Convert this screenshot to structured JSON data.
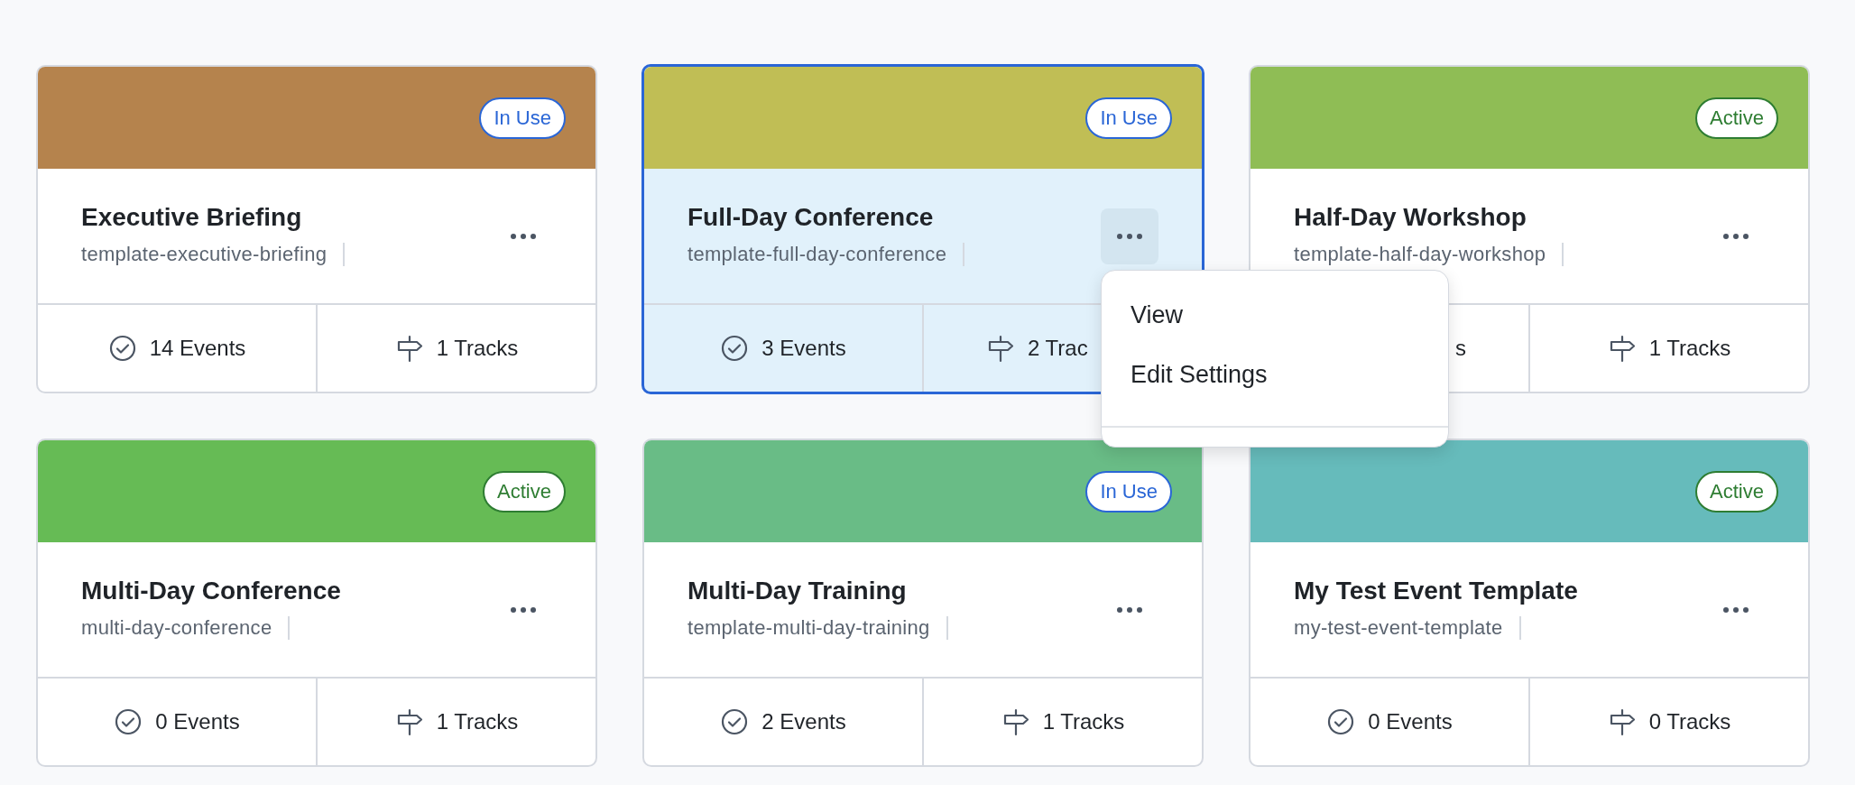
{
  "cards": [
    {
      "title": "Executive Briefing",
      "slug": "template-executive-briefing",
      "color": "#b5834d",
      "badge": {
        "label": "In Use",
        "kind": "in_use"
      },
      "selected": false,
      "events": {
        "text": "14 Events",
        "kind": "full"
      },
      "tracks": {
        "text": "1 Tracks",
        "kind": "full"
      }
    },
    {
      "title": "Full-Day Conference",
      "slug": "template-full-day-conference",
      "color": "#c0be55",
      "badge": {
        "label": "In Use",
        "kind": "in_use"
      },
      "selected": true,
      "events": {
        "text": "3 Events",
        "kind": "full"
      },
      "tracks": {
        "text": "2 Trac",
        "kind": "head"
      }
    },
    {
      "title": "Half-Day Workshop",
      "slug": "template-half-day-workshop",
      "color": "#8fbd55",
      "badge": {
        "label": "Active",
        "kind": "active"
      },
      "selected": false,
      "events": {
        "text": "s",
        "kind": "tail"
      },
      "tracks": {
        "text": "1 Tracks",
        "kind": "full"
      }
    },
    {
      "title": "Multi-Day Conference",
      "slug": "multi-day-conference",
      "color": "#66bb55",
      "badge": {
        "label": "Active",
        "kind": "active"
      },
      "selected": false,
      "events": {
        "text": "0 Events",
        "kind": "full"
      },
      "tracks": {
        "text": "1 Tracks",
        "kind": "full"
      }
    },
    {
      "title": "Multi-Day Training",
      "slug": "template-multi-day-training",
      "color": "#69bc86",
      "badge": {
        "label": "In Use",
        "kind": "in_use"
      },
      "selected": false,
      "events": {
        "text": "2 Events",
        "kind": "full"
      },
      "tracks": {
        "text": "1 Tracks",
        "kind": "full"
      }
    },
    {
      "title": "My Test Event Template",
      "slug": "my-test-event-template",
      "color": "#66bbbb",
      "badge": {
        "label": "Active",
        "kind": "active"
      },
      "selected": false,
      "events": {
        "text": "0 Events",
        "kind": "full"
      },
      "tracks": {
        "text": "0 Tracks",
        "kind": "full"
      }
    }
  ],
  "menu": {
    "items": [
      "View",
      "Edit Settings"
    ]
  }
}
